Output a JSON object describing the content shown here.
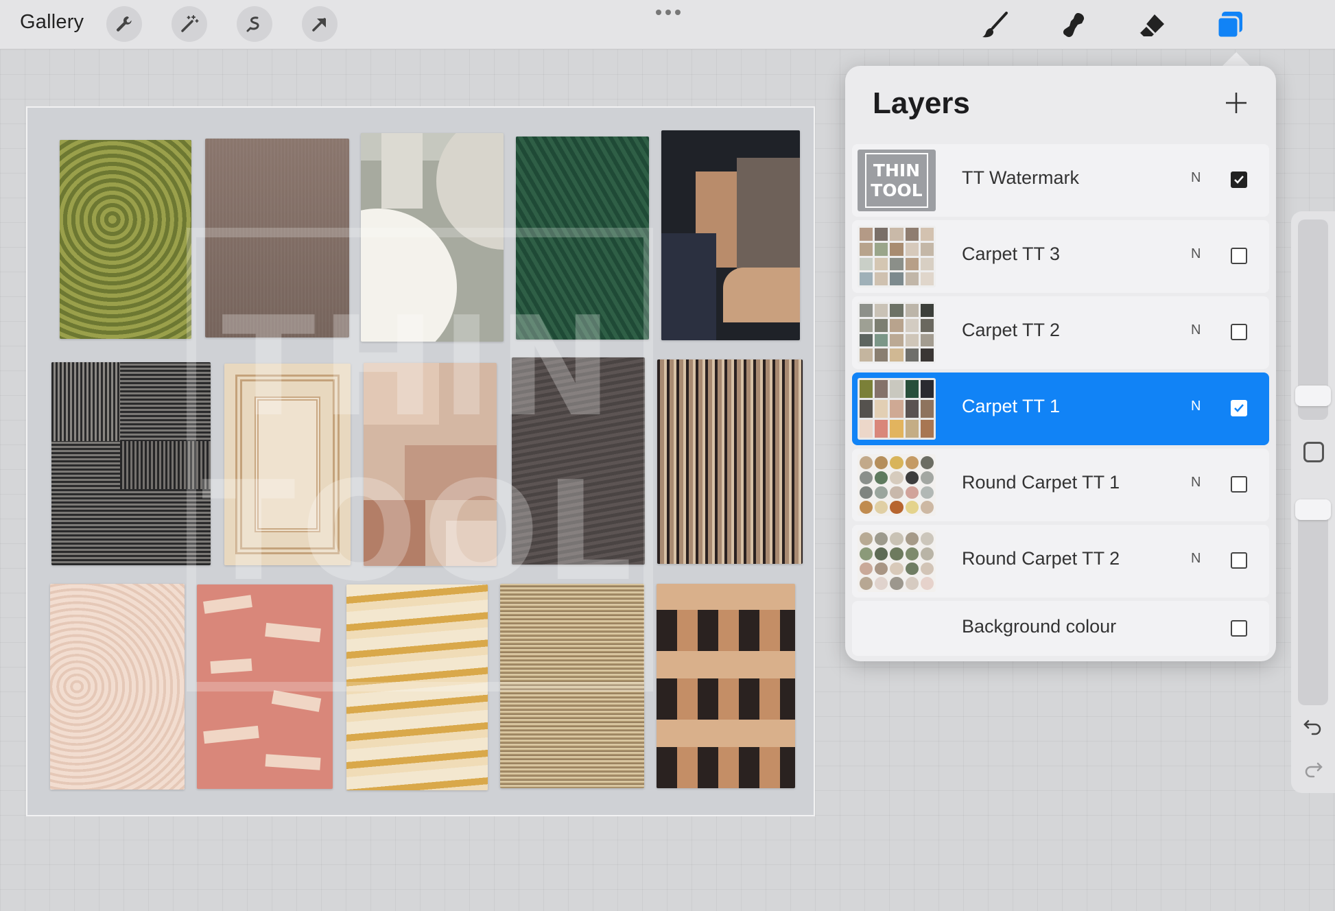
{
  "toolbar": {
    "gallery_label": "Gallery",
    "left_tools": [
      "wrench-icon",
      "magic-wand-icon",
      "selection-icon",
      "transform-arrow-icon"
    ],
    "right_tools": [
      "brush-icon",
      "smudge-icon",
      "eraser-icon",
      "layers-icon"
    ],
    "accent_color": "#1183f6"
  },
  "canvas": {
    "watermark_line1": "THIN",
    "watermark_line2": "TOOL"
  },
  "layers_panel": {
    "title": "Layers",
    "layers": [
      {
        "name": "TT Watermark",
        "blend": "N",
        "visible": true,
        "selected": false,
        "thumb_line1": "THIN",
        "thumb_line2": "TOOL"
      },
      {
        "name": "Carpet TT 3",
        "blend": "N",
        "visible": false,
        "selected": false
      },
      {
        "name": "Carpet TT 2",
        "blend": "N",
        "visible": false,
        "selected": false
      },
      {
        "name": "Carpet TT 1",
        "blend": "N",
        "visible": true,
        "selected": true
      },
      {
        "name": "Round Carpet TT 1",
        "blend": "N",
        "visible": false,
        "selected": false
      },
      {
        "name": "Round Carpet TT 2",
        "blend": "N",
        "visible": false,
        "selected": false
      },
      {
        "name": "Background colour",
        "blend": "",
        "visible": false,
        "selected": false
      }
    ]
  }
}
